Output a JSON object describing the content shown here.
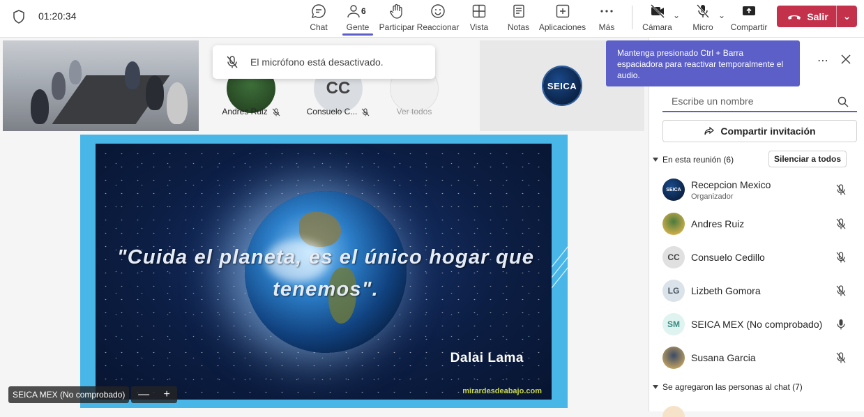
{
  "topbar": {
    "timer": "01:20:34",
    "buttons": {
      "chat": "Chat",
      "people": "Gente",
      "people_count": "6",
      "raise": "Participar",
      "react": "Reaccionar",
      "view": "Vista",
      "notes": "Notas",
      "apps": "Aplicaciones",
      "more": "Más",
      "camera": "Cámara",
      "mic": "Micro",
      "share": "Compartir"
    },
    "leave": "Salir"
  },
  "toast": {
    "text": "El micrófono está desactivado."
  },
  "strip": {
    "participants": [
      {
        "name": "Andres Ruiz"
      },
      {
        "name": "Consuelo C...",
        "initials": "CC"
      },
      {
        "name": "Ver todos"
      }
    ]
  },
  "seica_tile": {
    "logo_text": "SEICA"
  },
  "slide": {
    "quote": "\"Cuida el planeta, es el único hogar que tenemos\".",
    "author": "Dalai Lama",
    "site": "mirardesdeabajo.com"
  },
  "stage": {
    "presenter_label": "SEICA MEX (No comprobado)",
    "zoom_out": "—",
    "zoom_in": "+"
  },
  "panel": {
    "tooltip": "Mantenga presionado Ctrl + Barra espaciadora para reactivar temporalmente el audio.",
    "search_placeholder": "Escribe un nombre",
    "invite_label": "Compartir invitación",
    "in_meeting_header": "En esta reunión (6)",
    "mute_all": "Silenciar a todos",
    "participants": [
      {
        "name": "Recepcion Mexico",
        "role": "Organizador",
        "initials": "SEICA",
        "mic": "muted"
      },
      {
        "name": "Andres Ruiz",
        "initials": "",
        "mic": "muted"
      },
      {
        "name": "Consuelo Cedillo",
        "initials": "CC",
        "mic": "muted"
      },
      {
        "name": "Lizbeth Gomora",
        "initials": "LG",
        "mic": "muted"
      },
      {
        "name": "SEICA MEX (No comprobado)",
        "initials": "SM",
        "mic": "on"
      },
      {
        "name": "Susana Garcia",
        "initials": "",
        "mic": "muted"
      }
    ],
    "chat_header": "Se agregaron las personas al chat (7)"
  },
  "colors": {
    "accent": "#5b5fc7",
    "leave_red": "#c4314b",
    "slide_frame": "#49b6e8"
  }
}
